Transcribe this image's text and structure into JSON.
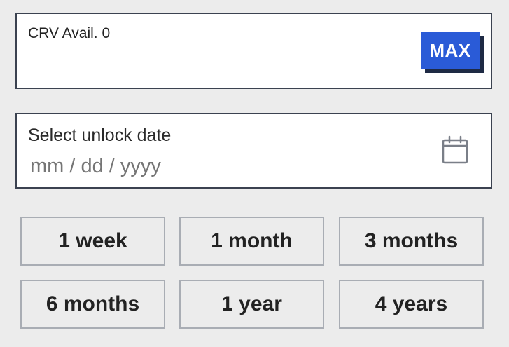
{
  "amount": {
    "label": "CRV Avail. 0",
    "max_label": "MAX"
  },
  "unlock": {
    "label": "Select unlock date",
    "placeholder": "mm / dd / yyyy"
  },
  "presets": [
    {
      "label": "1 week"
    },
    {
      "label": "1 month"
    },
    {
      "label": "3 months"
    },
    {
      "label": "6 months"
    },
    {
      "label": "1 year"
    },
    {
      "label": "4 years"
    }
  ],
  "colors": {
    "accent": "#2a5bd7",
    "background": "#ececec",
    "border": "#3b4250"
  },
  "icons": {
    "calendar": "calendar-icon"
  }
}
